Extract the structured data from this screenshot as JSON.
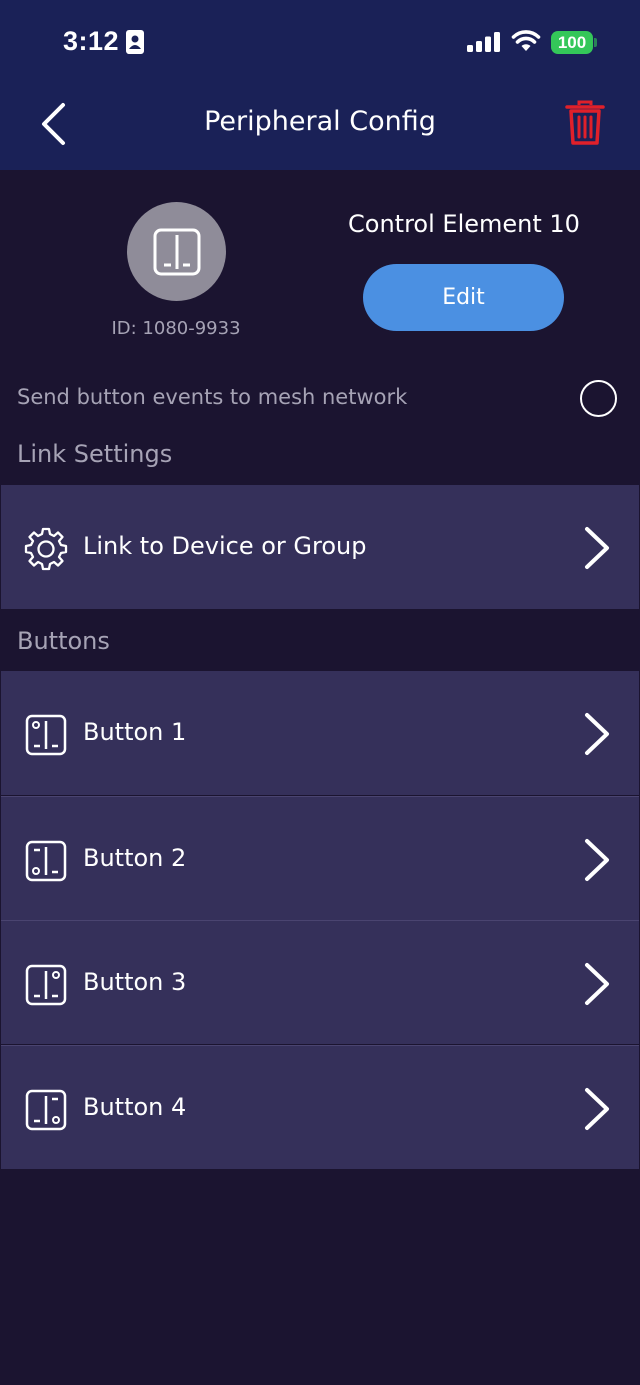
{
  "status_bar": {
    "time": "3:12",
    "battery": "100"
  },
  "header": {
    "title": "Peripheral Config",
    "back_icon": "chevron-left-icon",
    "delete_icon": "trash-icon",
    "delete_color": "#e0202a"
  },
  "device": {
    "name": "Control Element 10",
    "id_label": "ID: 1080-9933",
    "edit_label": "Edit",
    "edit_color": "#4b90e2"
  },
  "mesh": {
    "label": "Send button events to mesh network",
    "enabled": false
  },
  "link_settings": {
    "heading": "Link Settings",
    "item_label": "Link to Device or Group"
  },
  "buttons": {
    "heading": "Buttons",
    "items": [
      {
        "label": "Button 1"
      },
      {
        "label": "Button 2"
      },
      {
        "label": "Button 3"
      },
      {
        "label": "Button 4"
      }
    ]
  }
}
